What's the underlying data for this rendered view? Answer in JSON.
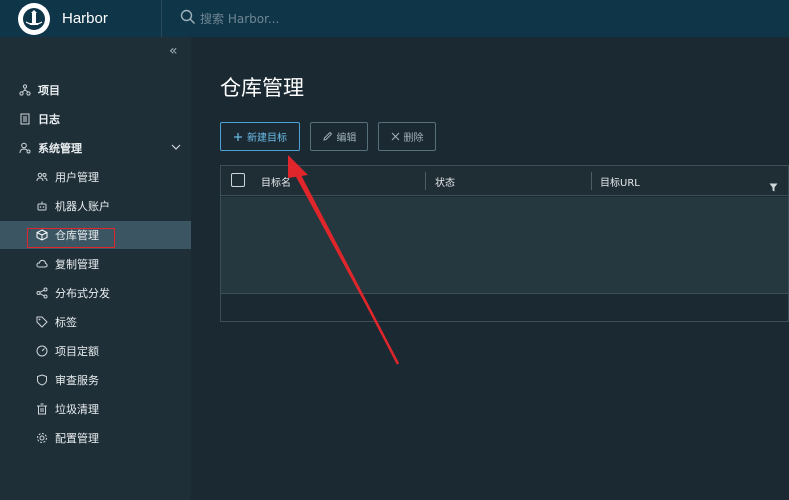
{
  "header": {
    "brand": "Harbor",
    "search_placeholder": "搜索 Harbor..."
  },
  "sidebar": {
    "collapse_glyph": "«",
    "items": [
      {
        "label": "项目",
        "icon": "project-icon"
      },
      {
        "label": "日志",
        "icon": "log-icon"
      },
      {
        "label": "系统管理",
        "icon": "admin-icon",
        "expanded": true
      },
      {
        "label": "用户管理",
        "icon": "users-icon"
      },
      {
        "label": "机器人账户",
        "icon": "robot-icon"
      },
      {
        "label": "仓库管理",
        "icon": "cube-icon",
        "active": true
      },
      {
        "label": "复制管理",
        "icon": "cloud-icon"
      },
      {
        "label": "分布式分发",
        "icon": "share-icon"
      },
      {
        "label": "标签",
        "icon": "tag-icon"
      },
      {
        "label": "项目定额",
        "icon": "gauge-icon"
      },
      {
        "label": "审查服务",
        "icon": "shield-icon"
      },
      {
        "label": "垃圾清理",
        "icon": "trash-icon"
      },
      {
        "label": "配置管理",
        "icon": "gear-icon"
      }
    ]
  },
  "main": {
    "title": "仓库管理",
    "toolbar": {
      "new_label": "新建目标",
      "edit_label": "编辑",
      "delete_label": "删除"
    },
    "grid": {
      "columns": [
        "目标名",
        "状态",
        "目标URL"
      ]
    }
  },
  "colors": {
    "header_bg": "#0f3549",
    "sidebar_bg": "#1f2f38",
    "main_bg": "#1b2a32",
    "accent": "#4aa3d6",
    "annotation": "#e0262b"
  }
}
